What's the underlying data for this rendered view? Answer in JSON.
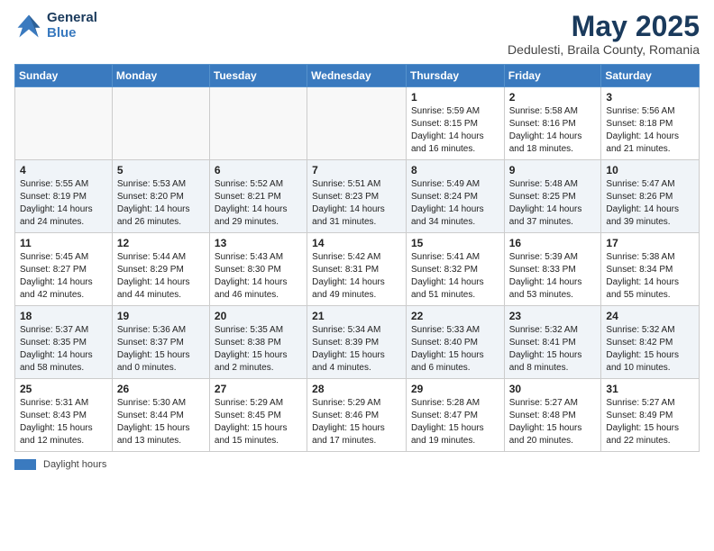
{
  "header": {
    "logo_general": "General",
    "logo_blue": "Blue",
    "main_title": "May 2025",
    "subtitle": "Dedulesti, Braila County, Romania"
  },
  "days_of_week": [
    "Sunday",
    "Monday",
    "Tuesday",
    "Wednesday",
    "Thursday",
    "Friday",
    "Saturday"
  ],
  "legend_label": "Daylight hours",
  "weeks": [
    [
      {
        "num": "",
        "info": ""
      },
      {
        "num": "",
        "info": ""
      },
      {
        "num": "",
        "info": ""
      },
      {
        "num": "",
        "info": ""
      },
      {
        "num": "1",
        "info": "Sunrise: 5:59 AM\nSunset: 8:15 PM\nDaylight: 14 hours\nand 16 minutes."
      },
      {
        "num": "2",
        "info": "Sunrise: 5:58 AM\nSunset: 8:16 PM\nDaylight: 14 hours\nand 18 minutes."
      },
      {
        "num": "3",
        "info": "Sunrise: 5:56 AM\nSunset: 8:18 PM\nDaylight: 14 hours\nand 21 minutes."
      }
    ],
    [
      {
        "num": "4",
        "info": "Sunrise: 5:55 AM\nSunset: 8:19 PM\nDaylight: 14 hours\nand 24 minutes."
      },
      {
        "num": "5",
        "info": "Sunrise: 5:53 AM\nSunset: 8:20 PM\nDaylight: 14 hours\nand 26 minutes."
      },
      {
        "num": "6",
        "info": "Sunrise: 5:52 AM\nSunset: 8:21 PM\nDaylight: 14 hours\nand 29 minutes."
      },
      {
        "num": "7",
        "info": "Sunrise: 5:51 AM\nSunset: 8:23 PM\nDaylight: 14 hours\nand 31 minutes."
      },
      {
        "num": "8",
        "info": "Sunrise: 5:49 AM\nSunset: 8:24 PM\nDaylight: 14 hours\nand 34 minutes."
      },
      {
        "num": "9",
        "info": "Sunrise: 5:48 AM\nSunset: 8:25 PM\nDaylight: 14 hours\nand 37 minutes."
      },
      {
        "num": "10",
        "info": "Sunrise: 5:47 AM\nSunset: 8:26 PM\nDaylight: 14 hours\nand 39 minutes."
      }
    ],
    [
      {
        "num": "11",
        "info": "Sunrise: 5:45 AM\nSunset: 8:27 PM\nDaylight: 14 hours\nand 42 minutes."
      },
      {
        "num": "12",
        "info": "Sunrise: 5:44 AM\nSunset: 8:29 PM\nDaylight: 14 hours\nand 44 minutes."
      },
      {
        "num": "13",
        "info": "Sunrise: 5:43 AM\nSunset: 8:30 PM\nDaylight: 14 hours\nand 46 minutes."
      },
      {
        "num": "14",
        "info": "Sunrise: 5:42 AM\nSunset: 8:31 PM\nDaylight: 14 hours\nand 49 minutes."
      },
      {
        "num": "15",
        "info": "Sunrise: 5:41 AM\nSunset: 8:32 PM\nDaylight: 14 hours\nand 51 minutes."
      },
      {
        "num": "16",
        "info": "Sunrise: 5:39 AM\nSunset: 8:33 PM\nDaylight: 14 hours\nand 53 minutes."
      },
      {
        "num": "17",
        "info": "Sunrise: 5:38 AM\nSunset: 8:34 PM\nDaylight: 14 hours\nand 55 minutes."
      }
    ],
    [
      {
        "num": "18",
        "info": "Sunrise: 5:37 AM\nSunset: 8:35 PM\nDaylight: 14 hours\nand 58 minutes."
      },
      {
        "num": "19",
        "info": "Sunrise: 5:36 AM\nSunset: 8:37 PM\nDaylight: 15 hours\nand 0 minutes."
      },
      {
        "num": "20",
        "info": "Sunrise: 5:35 AM\nSunset: 8:38 PM\nDaylight: 15 hours\nand 2 minutes."
      },
      {
        "num": "21",
        "info": "Sunrise: 5:34 AM\nSunset: 8:39 PM\nDaylight: 15 hours\nand 4 minutes."
      },
      {
        "num": "22",
        "info": "Sunrise: 5:33 AM\nSunset: 8:40 PM\nDaylight: 15 hours\nand 6 minutes."
      },
      {
        "num": "23",
        "info": "Sunrise: 5:32 AM\nSunset: 8:41 PM\nDaylight: 15 hours\nand 8 minutes."
      },
      {
        "num": "24",
        "info": "Sunrise: 5:32 AM\nSunset: 8:42 PM\nDaylight: 15 hours\nand 10 minutes."
      }
    ],
    [
      {
        "num": "25",
        "info": "Sunrise: 5:31 AM\nSunset: 8:43 PM\nDaylight: 15 hours\nand 12 minutes."
      },
      {
        "num": "26",
        "info": "Sunrise: 5:30 AM\nSunset: 8:44 PM\nDaylight: 15 hours\nand 13 minutes."
      },
      {
        "num": "27",
        "info": "Sunrise: 5:29 AM\nSunset: 8:45 PM\nDaylight: 15 hours\nand 15 minutes."
      },
      {
        "num": "28",
        "info": "Sunrise: 5:29 AM\nSunset: 8:46 PM\nDaylight: 15 hours\nand 17 minutes."
      },
      {
        "num": "29",
        "info": "Sunrise: 5:28 AM\nSunset: 8:47 PM\nDaylight: 15 hours\nand 19 minutes."
      },
      {
        "num": "30",
        "info": "Sunrise: 5:27 AM\nSunset: 8:48 PM\nDaylight: 15 hours\nand 20 minutes."
      },
      {
        "num": "31",
        "info": "Sunrise: 5:27 AM\nSunset: 8:49 PM\nDaylight: 15 hours\nand 22 minutes."
      }
    ]
  ]
}
